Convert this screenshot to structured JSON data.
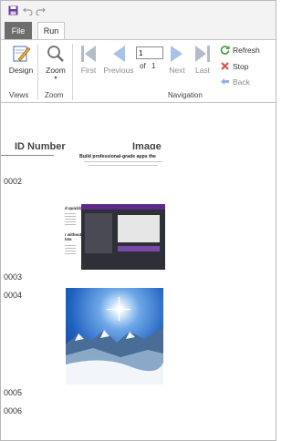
{
  "tabs": {
    "file": "File",
    "run": "Run"
  },
  "ribbon": {
    "design": "Design",
    "zoom": "Zoom",
    "first": "First",
    "previous": "Previous",
    "next": "Next",
    "last": "Last",
    "refresh": "Refresh",
    "stop": "Stop",
    "back": "Back",
    "page_value": "1",
    "of_label": "of",
    "page_total": "1",
    "groups": {
      "views": "Views",
      "zoom": "Zoom",
      "navigation": "Navigation"
    }
  },
  "report": {
    "columns": {
      "id": "ID Number",
      "image": "Image"
    },
    "rows": [
      "0002",
      "0003",
      "0004",
      "0005",
      "0006"
    ],
    "doc_thumb": {
      "heading": "Build professional-grade apps the",
      "section1": "d quickly",
      "section2": "r without\nlots"
    }
  },
  "colors": {
    "accent": "#2b7cd3",
    "green": "#3a9a3a",
    "red": "#d9534f"
  }
}
